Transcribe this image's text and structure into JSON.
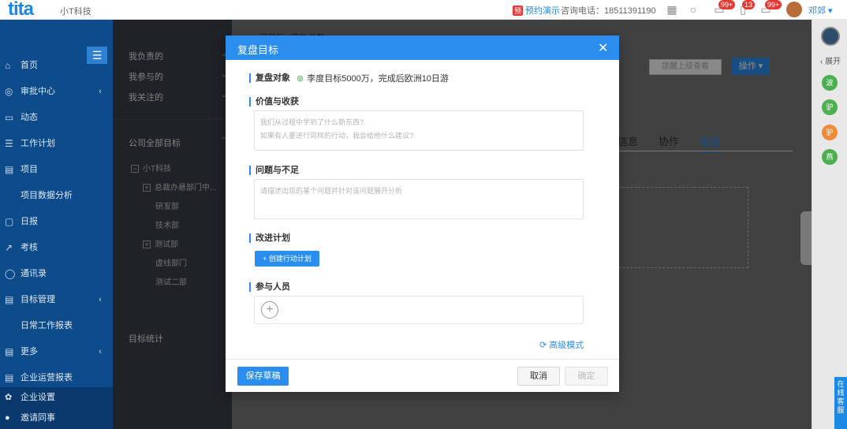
{
  "topbar": {
    "logo": "tita",
    "company": "小T科技",
    "demo_badge": "预",
    "demo_link": "预约演示",
    "phone": "咨询电话：18511391190",
    "badges": [
      "99+",
      "13",
      "99+"
    ],
    "user": "邓郊 ▾"
  },
  "sidebar": {
    "menu_icon": "☰",
    "items": [
      {
        "icon": "⌂",
        "label": "首页"
      },
      {
        "icon": "◎",
        "label": "审批中心",
        "chev": "‹"
      },
      {
        "icon": "▭",
        "label": "动态"
      },
      {
        "icon": "☰",
        "label": "工作计划"
      },
      {
        "icon": "▤",
        "label": "项目"
      },
      {
        "icon": "",
        "label": "项目数据分析"
      },
      {
        "icon": "▢",
        "label": "日报"
      },
      {
        "icon": "↗",
        "label": "考核"
      },
      {
        "icon": "◯",
        "label": "通讯录"
      },
      {
        "icon": "▤",
        "label": "目标管理",
        "chev": "‹"
      },
      {
        "icon": "",
        "label": "日常工作报表"
      },
      {
        "icon": "▤",
        "label": "更多",
        "chev": "‹"
      },
      {
        "icon": "▤",
        "label": "企业运营报表"
      }
    ],
    "bottom": [
      {
        "icon": "✿",
        "label": "企业设置"
      },
      {
        "icon": "●",
        "label": "邀请同事"
      }
    ]
  },
  "col2": {
    "my_items": [
      {
        "label": "我负责的",
        "chev": "⌄"
      },
      {
        "label": "我参与的",
        "chev": "⌄"
      },
      {
        "label": "我关注的",
        "chev": "⌄"
      }
    ],
    "company_goals": "公司全部目标",
    "company_chev": "⌃",
    "tree": [
      {
        "label": "小T科技",
        "box": "−"
      },
      {
        "label": "总裁办悬部门中...",
        "box": "+"
      },
      {
        "label": "研发部",
        "box": ""
      },
      {
        "label": "技术部",
        "box": ""
      },
      {
        "label": "测试部",
        "box": "+"
      },
      {
        "label": "虚线部门",
        "box": ""
      },
      {
        "label": "测试二部",
        "box": ""
      }
    ],
    "stats": "目标统计"
  },
  "background": {
    "breadcrumb": "目目标 › 第二 单数",
    "remind": "提醒上级查看",
    "ops": "操作 ▾",
    "tabs": [
      "信息",
      "协作",
      "复盘"
    ]
  },
  "rail": {
    "expand": "‹ 展开",
    "avatars": [
      {
        "label": "波",
        "color": "#4caf50"
      },
      {
        "label": "驴",
        "color": "#4caf50"
      },
      {
        "label": "驴",
        "color": "#ef8c3a"
      },
      {
        "label": "燕",
        "color": "#4caf50"
      }
    ],
    "chat": "在线客服"
  },
  "modal": {
    "title": "复盘目标",
    "close": "✕",
    "review_object_label": "复盘对象",
    "review_object_value": "李度目标5000万，完成后欧洲10日游",
    "value_label": "价值与收获",
    "value_placeholder_1": "我们从过程中学到了什么新东西?",
    "value_placeholder_2": "如果有人要进行同样的行动，我会给他什么建议?",
    "problem_label": "问题与不足",
    "problem_placeholder": "请描述出现的某个问题并针对该问题展开分析",
    "plan_label": "改进计划",
    "create_plan": "+ 创建行动计划",
    "people_label": "参与人员",
    "add": "+",
    "advanced": "⟳ 高级模式",
    "save_draft": "保存草稿",
    "cancel": "取消",
    "confirm": "确定"
  }
}
